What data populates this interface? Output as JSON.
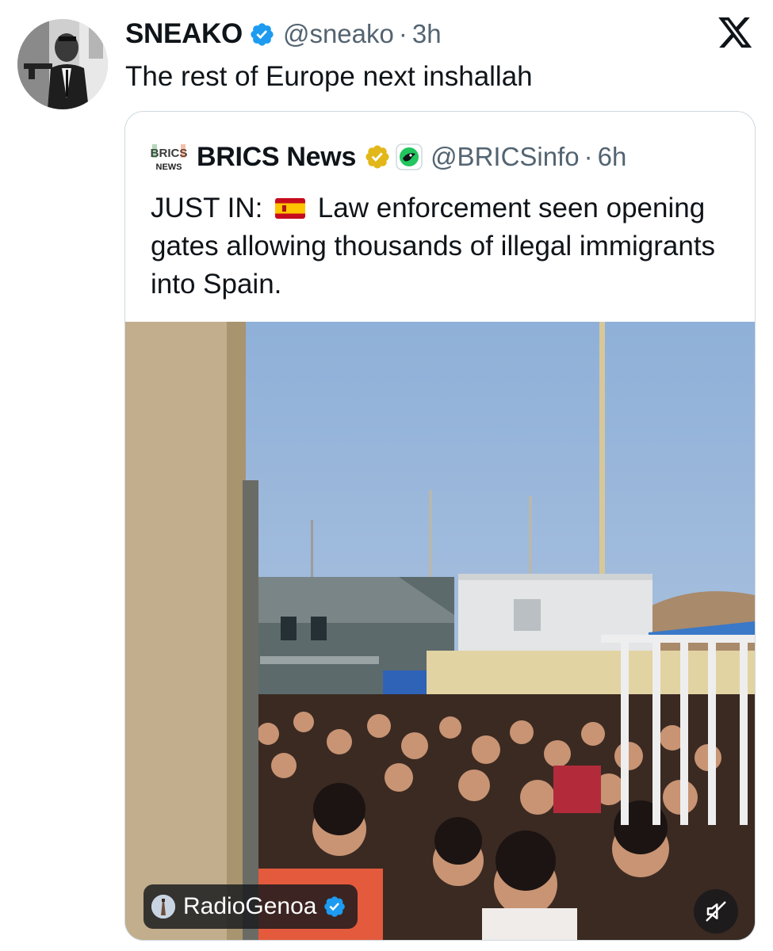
{
  "tweet": {
    "author": {
      "display_name": "SNEAKO",
      "handle": "@sneako",
      "verified_color": "#1d9bf0"
    },
    "separator": "·",
    "time": "3h",
    "text": "The rest of Europe next inshallah",
    "platform_icon": "x-logo-icon"
  },
  "quoted_tweet": {
    "logo_text_top": "BRICS",
    "logo_text_bottom": "NEWS",
    "display_name": "BRICS News",
    "verified_color": "#e2b719",
    "affiliate_badge": "affiliate-badge-icon",
    "handle": "@BRICSinfo",
    "separator": "·",
    "time": "6h",
    "text_prefix": "JUST IN:",
    "flag": "spain-flag-icon",
    "text_body": "Law enforcement seen opening gates allowing thousands of illegal immigrants into Spain.",
    "media": {
      "source_name": "RadioGenoa",
      "source_verified_color": "#1d9bf0",
      "mute_icon": "speaker-muted-icon"
    }
  }
}
